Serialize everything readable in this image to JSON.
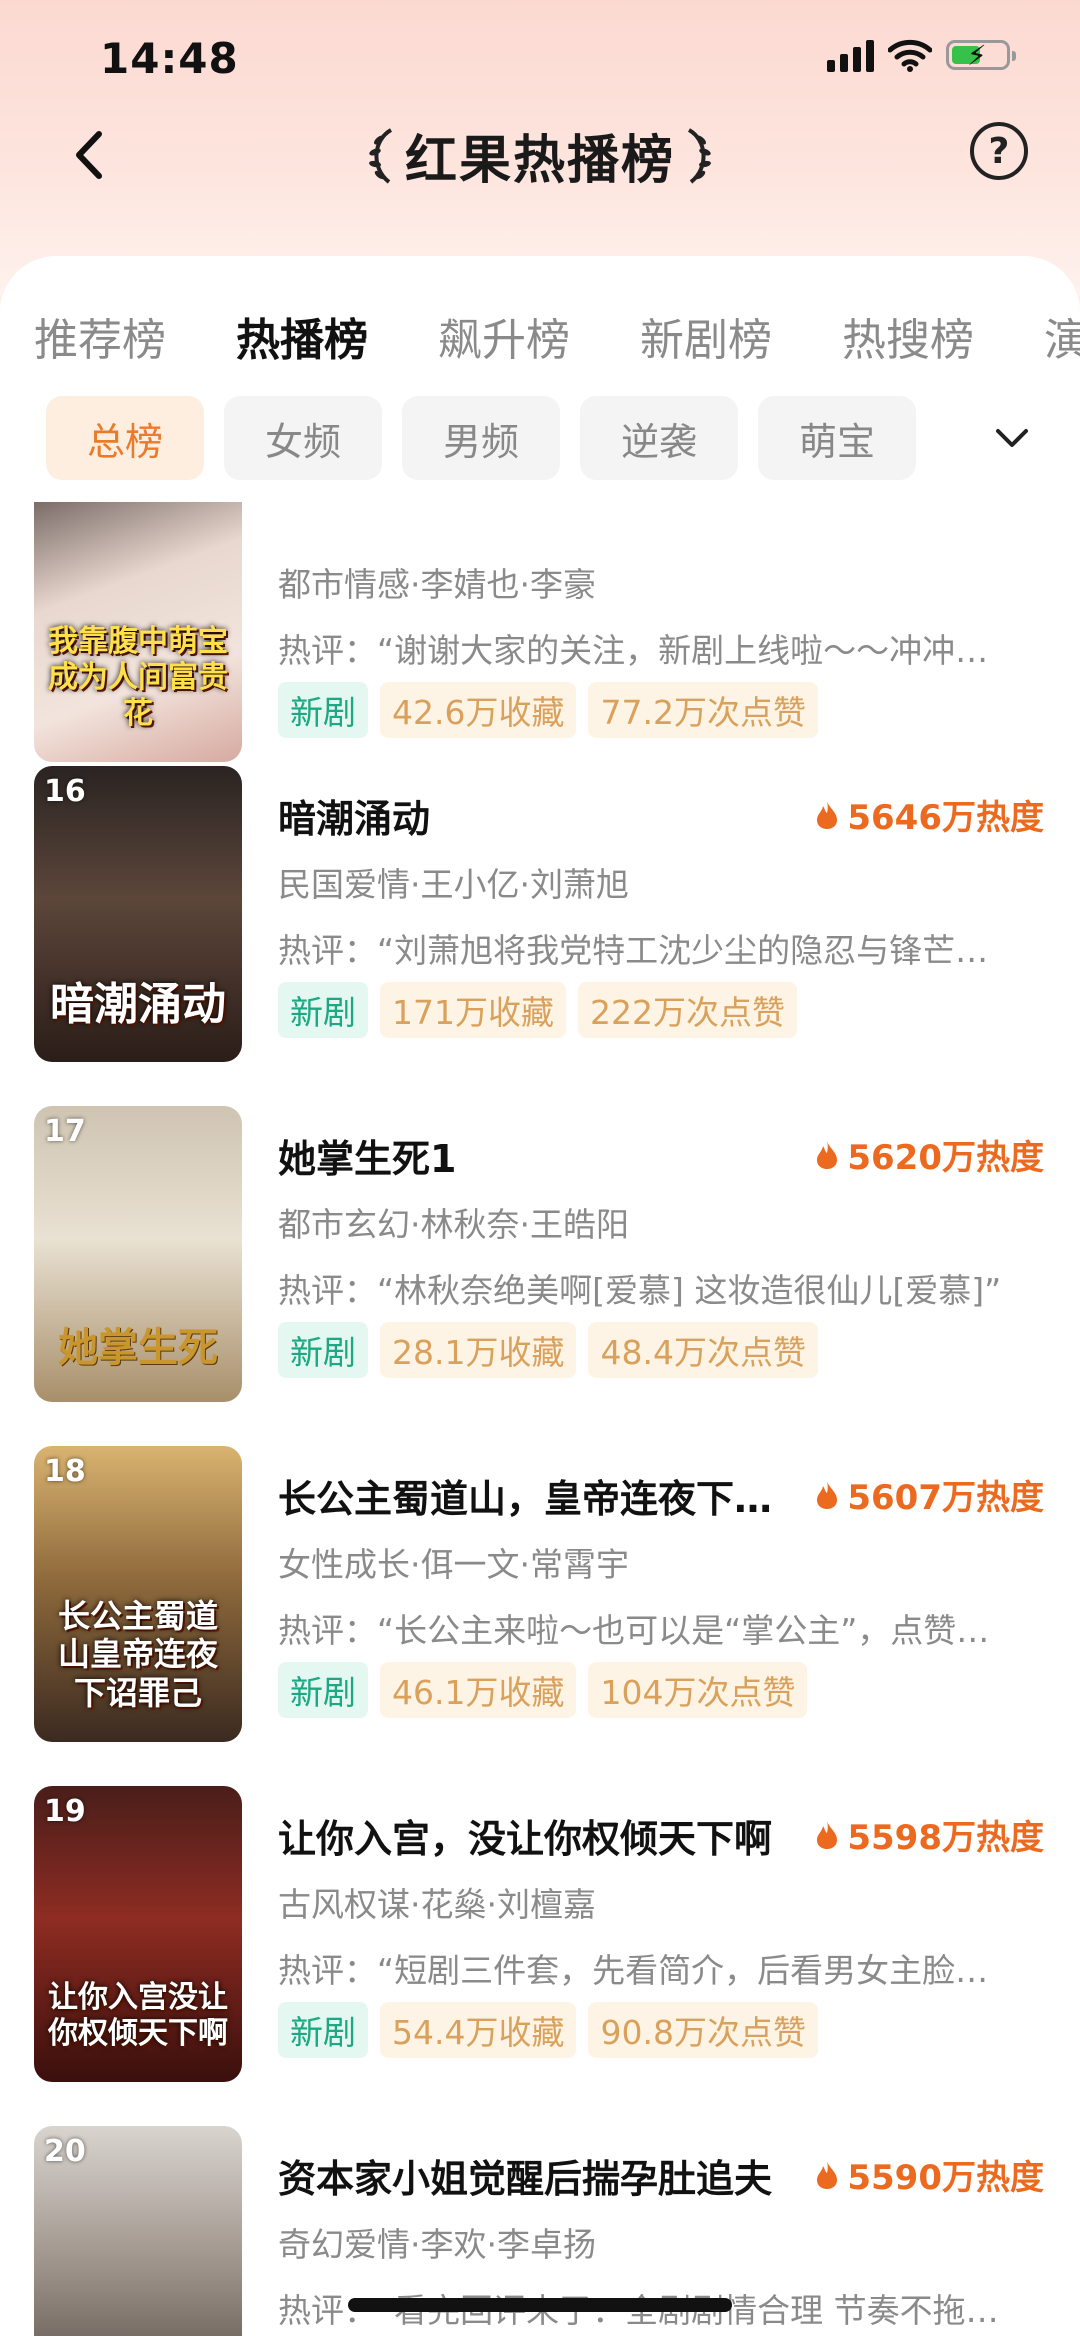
{
  "status": {
    "time": "14:48"
  },
  "nav": {
    "title": "红果热播榜"
  },
  "tabs": [
    "推荐榜",
    "热播榜",
    "飙升榜",
    "新剧榜",
    "热搜榜",
    "演"
  ],
  "chips": [
    "总榜",
    "女频",
    "男频",
    "逆袭",
    "萌宝"
  ],
  "items": [
    {
      "rank": "",
      "title": "",
      "heat": "",
      "meta": "都市情感·李婧也·李豪",
      "review": "热评：“谢谢大家的关注，新剧上线啦～～冲冲…",
      "tag_new": "新剧",
      "collect": "42.6万收藏",
      "likes": "77.2万次点赞",
      "cover_text": "我靠腹中萌宝成为人间富贵花"
    },
    {
      "rank": "16",
      "title": "暗潮涌动",
      "heat": "5646万热度",
      "meta": "民国爱情·王小亿·刘萧旭",
      "review": "热评：“刘萧旭将我党特工沈少尘的隐忍与锋芒…",
      "tag_new": "新剧",
      "collect": "171万收藏",
      "likes": "222万次点赞",
      "cover_text": "暗潮涌动"
    },
    {
      "rank": "17",
      "title": "她掌生死1",
      "heat": "5620万热度",
      "meta": "都市玄幻·林秋奈·王皓阳",
      "review": "热评：“林秋奈绝美啊[爱慕] 这妆造很仙儿[爱慕]”",
      "tag_new": "新剧",
      "collect": "28.1万收藏",
      "likes": "48.4万次点赞",
      "cover_text": "她掌生死"
    },
    {
      "rank": "18",
      "title": "长公主蜀道山，皇帝连夜下…",
      "heat": "5607万热度",
      "meta": "女性成长·佴一文·常霄宇",
      "review": "热评：“长公主来啦～也可以是“掌公主”，点赞…",
      "tag_new": "新剧",
      "collect": "46.1万收藏",
      "likes": "104万次点赞",
      "cover_text": "长公主蜀道山皇帝连夜下诏罪己"
    },
    {
      "rank": "19",
      "title": "让你入宫，没让你权倾天下啊",
      "heat": "5598万热度",
      "meta": "古风权谋·花燊·刘檀嘉",
      "review": "热评：“短剧三件套，先看简介，后看男女主脸…",
      "tag_new": "新剧",
      "collect": "54.4万收藏",
      "likes": "90.8万次点赞",
      "cover_text": "让你入宫没让你权倾天下啊"
    },
    {
      "rank": "20",
      "title": "资本家小姐觉醒后揣孕肚追夫",
      "heat": "5590万热度",
      "meta": "奇幻爱情·李欢·李卓扬",
      "review": "热评：“看完回评来了：全剧剧情合理 节奏不拖…",
      "tag_new": "",
      "collect": "",
      "likes": "",
      "cover_text": ""
    }
  ]
}
